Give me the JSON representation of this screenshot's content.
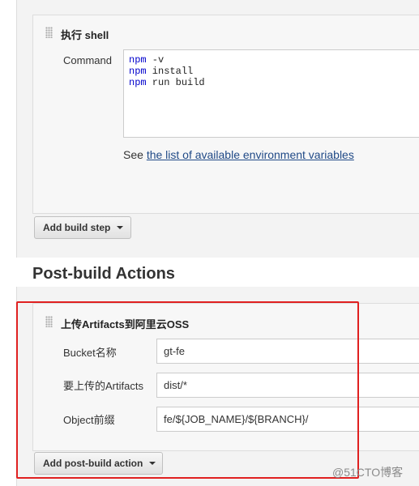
{
  "build": {
    "step_title": "执行 shell",
    "command_label": "Command",
    "command_lines": [
      {
        "cmd": "npm",
        "args": " -v"
      },
      {
        "cmd": "npm",
        "args": " install"
      },
      {
        "cmd": "npm",
        "args": " run build"
      }
    ],
    "see_prefix": "See ",
    "see_link": "the list of available environment variables",
    "add_step_label": "Add build step"
  },
  "post_build": {
    "heading": "Post-build Actions",
    "action_title": "上传Artifacts到阿里云OSS",
    "fields": [
      {
        "label": "Bucket名称",
        "value": "gt-fe"
      },
      {
        "label": "要上传的Artifacts",
        "value": "dist/*"
      },
      {
        "label": "Object前缀",
        "value": "fe/${JOB_NAME}/${BRANCH}/"
      }
    ],
    "add_action_label": "Add post-build action"
  },
  "watermark": "@51CTO博客",
  "colors": {
    "highlight": "#e02020",
    "link": "#204a87"
  }
}
